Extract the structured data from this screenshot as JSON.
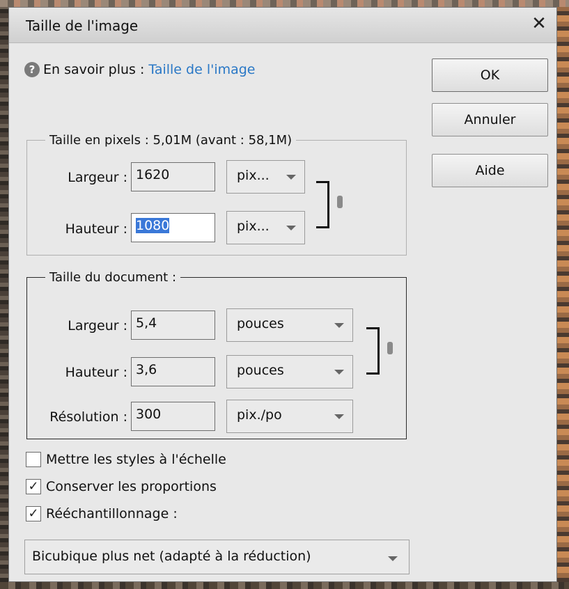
{
  "window": {
    "title": "Taille de l'image",
    "close_label": "✕"
  },
  "help": {
    "icon": "?",
    "prefix": "En savoir plus :",
    "link": "Taille de l'image"
  },
  "buttons": {
    "ok": "OK",
    "cancel": "Annuler",
    "help": "Aide"
  },
  "pixel_size": {
    "legend": "Taille en pixels : 5,01M (avant : 58,1M)",
    "width_label": "Largeur :",
    "width_value": "1620",
    "width_unit": "pix...",
    "height_label": "Hauteur :",
    "height_value": "1080",
    "height_unit": "pix..."
  },
  "document_size": {
    "legend": "Taille du document :",
    "width_label": "Largeur :",
    "width_value": "5,4",
    "width_unit": "pouces",
    "height_label": "Hauteur :",
    "height_value": "3,6",
    "height_unit": "pouces",
    "resolution_label": "Résolution :",
    "resolution_value": "300",
    "resolution_unit": "pix./po"
  },
  "options": {
    "scale_styles": {
      "label": "Mettre les styles à l'échelle",
      "checked": false
    },
    "constrain_proportions": {
      "label": "Conserver les proportions",
      "checked": true,
      "mark": "✓"
    },
    "resample": {
      "label": "Rééchantillonnage :",
      "checked": true,
      "mark": "✓"
    }
  },
  "resample_method": "Bicubique plus net (adapté à la réduction)"
}
